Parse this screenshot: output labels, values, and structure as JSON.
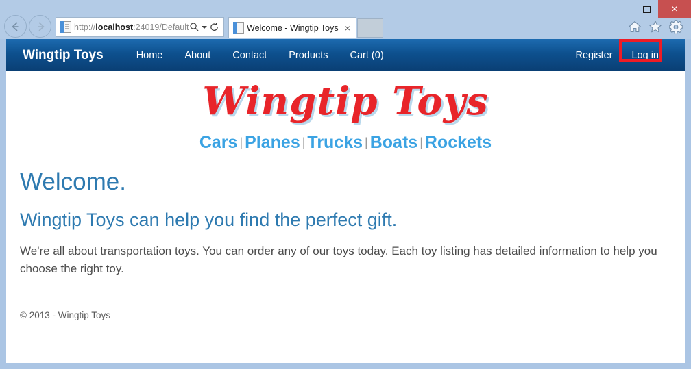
{
  "browser": {
    "back_label": "Back",
    "forward_label": "Forward",
    "url_scheme": "http://",
    "url_host": "localhost",
    "url_rest": ":24019/Default",
    "url_full": "http://localhost:24019/Default",
    "search_icon": "search-icon",
    "dropdown_icon": "chevron-down-icon",
    "refresh_icon": "refresh-icon",
    "tab_title": "Welcome - Wingtip Toys",
    "tab_close_label": "×",
    "new_tab_label": "",
    "home_icon": "home-icon",
    "favorites_icon": "star-icon",
    "settings_icon": "gear-icon",
    "minimize_label": "Minimize",
    "maximize_label": "Maximize",
    "close_label": "×"
  },
  "navbar": {
    "brand": "Wingtip Toys",
    "links": [
      {
        "label": "Home"
      },
      {
        "label": "About"
      },
      {
        "label": "Contact"
      },
      {
        "label": "Products"
      },
      {
        "label": "Cart (0)"
      }
    ],
    "right_links": [
      {
        "label": "Register"
      },
      {
        "label": "Log in"
      }
    ],
    "highlight_color": "#ee1c25"
  },
  "page": {
    "logo_text": "Wingtip Toys",
    "categories": [
      {
        "label": "Cars"
      },
      {
        "label": "Planes"
      },
      {
        "label": "Trucks"
      },
      {
        "label": "Boats"
      },
      {
        "label": "Rockets"
      }
    ],
    "separator": "|",
    "heading": "Welcome.",
    "subheading": "Wingtip Toys can help you find the perfect gift.",
    "paragraph": "We're all about transportation toys. You can order any of our toys today. Each toy listing has detailed information to help you choose the right toy.",
    "footer": "© 2013 - Wingtip Toys"
  }
}
